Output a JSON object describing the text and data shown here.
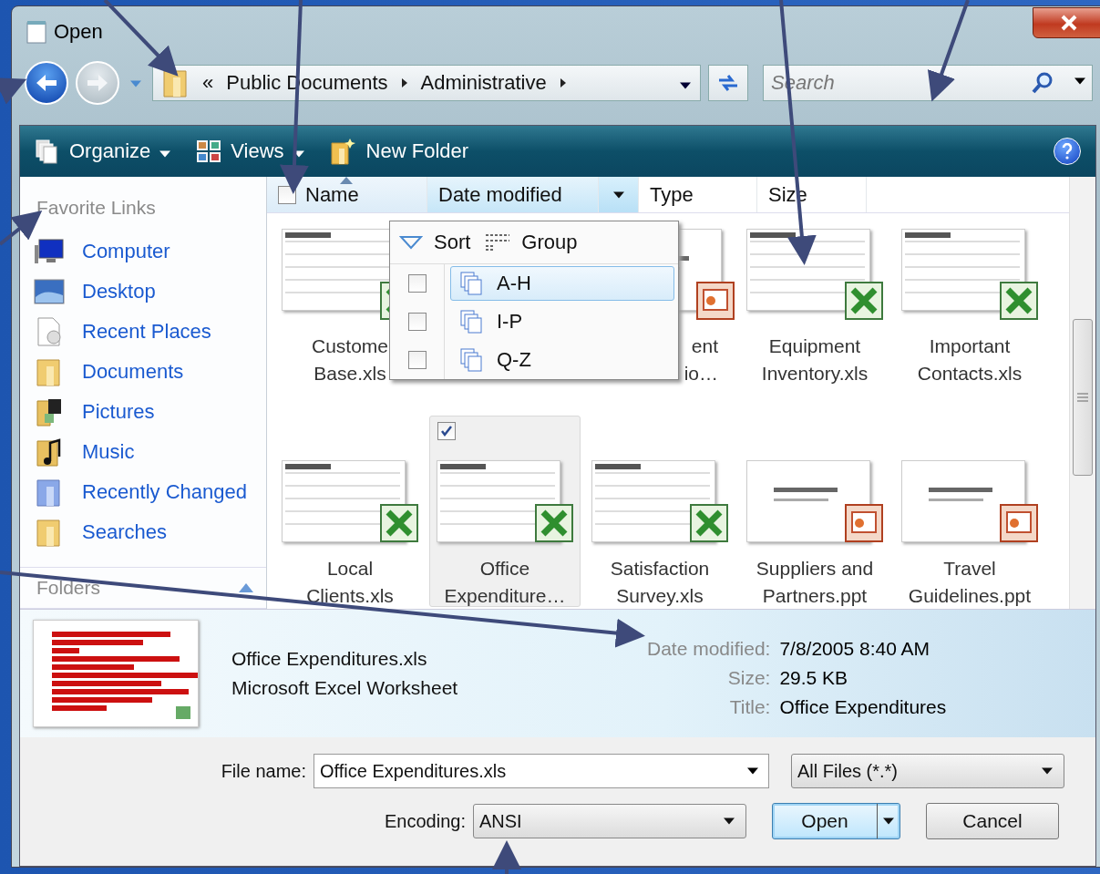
{
  "window": {
    "title": "Open"
  },
  "address_bar": {
    "overflow": "«",
    "crumbs": [
      "Public Documents",
      "Administrative"
    ]
  },
  "search": {
    "placeholder": "Search"
  },
  "toolbar": [
    {
      "label": "Organize",
      "kind": "organize",
      "menu": true
    },
    {
      "label": "Views",
      "kind": "views",
      "menu": true
    },
    {
      "label": "New Folder",
      "kind": "new-folder",
      "menu": false
    }
  ],
  "sidebar": {
    "heading": "Favorite Links",
    "folders_label": "Folders",
    "items": [
      {
        "label": "Computer",
        "kind": "computer"
      },
      {
        "label": "Desktop",
        "kind": "desktop"
      },
      {
        "label": "Recent Places",
        "kind": "recent"
      },
      {
        "label": "Documents",
        "kind": "folder"
      },
      {
        "label": "Pictures",
        "kind": "pictures"
      },
      {
        "label": "Music",
        "kind": "music"
      },
      {
        "label": "Recently Changed",
        "kind": "changed"
      },
      {
        "label": "Searches",
        "kind": "folder"
      }
    ]
  },
  "columns": [
    {
      "label": "Name",
      "sorted": true,
      "hover": false
    },
    {
      "label": "Date modified",
      "sorted": false,
      "hover": true
    },
    {
      "label": "Type",
      "sorted": false,
      "hover": false
    },
    {
      "label": "Size",
      "sorted": false,
      "hover": false
    }
  ],
  "column_menu": {
    "sort_label": "Sort",
    "group_label": "Group",
    "items": [
      {
        "label": "A-H",
        "checked": false,
        "selected": true
      },
      {
        "label": "I-P",
        "checked": false,
        "selected": false
      },
      {
        "label": "Q-Z",
        "checked": false,
        "selected": false
      }
    ]
  },
  "files": [
    {
      "lines": [
        "Custome",
        "Base.xls"
      ],
      "kind": "xls",
      "covered": false,
      "selected": false,
      "checked": false
    },
    {
      "kind": "hidden"
    },
    {
      "lines": [
        "ent",
        "io…"
      ],
      "kind": "ppt",
      "covered": true,
      "selected": false
    },
    {
      "lines": [
        "Equipment",
        "Inventory.xls"
      ],
      "kind": "xls",
      "covered": false,
      "selected": false,
      "checked": false
    },
    {
      "lines": [
        "Important",
        "Contacts.xls"
      ],
      "kind": "xls",
      "covered": false,
      "selected": false,
      "checked": false
    },
    {
      "lines": [
        "Local",
        "Clients.xls"
      ],
      "kind": "xls",
      "covered": false,
      "selected": false,
      "checked": false
    },
    {
      "lines": [
        "Office",
        "Expenditure…"
      ],
      "kind": "xls",
      "covered": false,
      "selected": true,
      "checked": true
    },
    {
      "lines": [
        "Satisfaction",
        "Survey.xls"
      ],
      "kind": "xls",
      "covered": false,
      "selected": false,
      "checked": false
    },
    {
      "lines": [
        "Suppliers and",
        "Partners.ppt"
      ],
      "kind": "ppt",
      "covered": false,
      "selected": false,
      "checked": false
    },
    {
      "lines": [
        "Travel",
        "Guidelines.ppt"
      ],
      "kind": "ppt",
      "covered": false,
      "selected": false,
      "checked": false
    }
  ],
  "details": {
    "name": "Office Expenditures.xls",
    "type": "Microsoft Excel Worksheet",
    "properties": [
      {
        "label": "Date modified:",
        "value": "7/8/2005 8:40 AM"
      },
      {
        "label": "Size:",
        "value": "29.5 KB"
      },
      {
        "label": "Title:",
        "value": "Office Expenditures"
      }
    ]
  },
  "file_name": {
    "label": "File name:",
    "value": "Office Expenditures.xls"
  },
  "file_type": {
    "value": "All Files  (*.*)"
  },
  "encoding": {
    "label": "Encoding:",
    "value": "ANSI"
  },
  "buttons": [
    {
      "label": "Open",
      "kind": "split",
      "default": true
    },
    {
      "label": "Cancel",
      "kind": "plain",
      "default": false
    }
  ]
}
